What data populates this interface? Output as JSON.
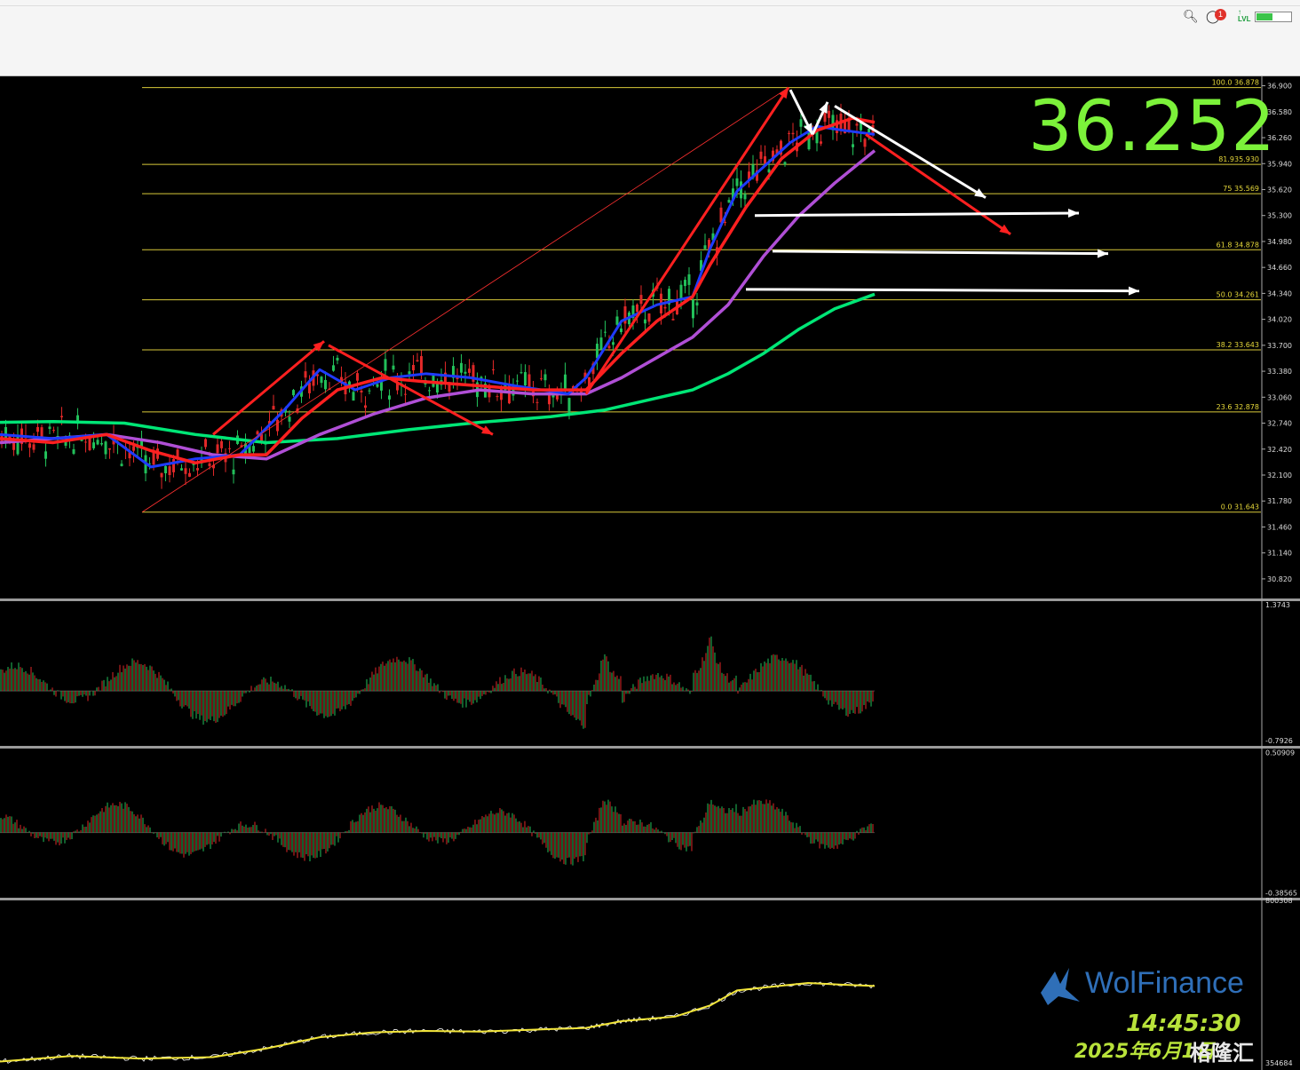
{
  "topbar": {
    "notification_count": "1",
    "lvl_label": "LVL",
    "battery_level": 0.45
  },
  "overlay": {
    "big_price": "36.252",
    "logo": "WolFinance",
    "clock": "14:45:30",
    "date": "2025年6月1日",
    "watermark": "格隆汇"
  },
  "chart_data": [
    {
      "type": "line",
      "panel": "price",
      "y_ticks": [
        "36.900",
        "36.580",
        "36.260",
        "35.940",
        "35.620",
        "35.300",
        "34.980",
        "34.660",
        "34.340",
        "34.020",
        "33.700",
        "33.380",
        "33.060",
        "32.740",
        "32.420",
        "32.100",
        "31.780",
        "31.460",
        "31.140",
        "30.820"
      ],
      "ylim": [
        30.6,
        36.95
      ],
      "fib_levels": [
        {
          "label": "100.0 36.878",
          "value": 36.878
        },
        {
          "label": "81.935.930",
          "value": 35.93
        },
        {
          "label": "75 35.569",
          "value": 35.569
        },
        {
          "label": "61.8 34.878",
          "value": 34.878
        },
        {
          "label": "50.0 34.261",
          "value": 34.261
        },
        {
          "label": "38.2 33.643",
          "value": 33.643
        },
        {
          "label": "23.6 32.878",
          "value": 32.878
        },
        {
          "label": "0.0 31.643",
          "value": 31.643
        }
      ],
      "series": [
        {
          "color": "#00e676",
          "x": [
            0,
            60,
            140,
            220,
            300,
            380,
            460,
            540,
            620,
            680,
            740,
            780,
            820,
            860,
            900,
            940,
            985
          ],
          "values": [
            32.75,
            32.76,
            32.74,
            32.6,
            32.5,
            32.55,
            32.66,
            32.75,
            32.82,
            32.9,
            33.05,
            33.15,
            33.35,
            33.6,
            33.9,
            34.15,
            34.33
          ]
        },
        {
          "color": "#b04fd6",
          "x": [
            0,
            60,
            120,
            180,
            240,
            300,
            360,
            420,
            480,
            540,
            600,
            660,
            700,
            740,
            780,
            820,
            860,
            900,
            940,
            985
          ],
          "values": [
            32.5,
            32.55,
            32.6,
            32.5,
            32.35,
            32.3,
            32.6,
            32.85,
            33.05,
            33.15,
            33.1,
            33.1,
            33.3,
            33.55,
            33.8,
            34.2,
            34.8,
            35.3,
            35.7,
            36.1
          ]
        },
        {
          "color": "#1f3bff",
          "x": [
            0,
            60,
            120,
            170,
            220,
            270,
            320,
            360,
            400,
            440,
            480,
            530,
            580,
            640,
            660,
            700,
            740,
            780,
            800,
            830,
            860,
            890,
            920,
            950,
            985
          ],
          "values": [
            32.6,
            32.55,
            32.6,
            32.2,
            32.3,
            32.35,
            32.9,
            33.4,
            33.15,
            33.3,
            33.35,
            33.3,
            33.2,
            33.1,
            33.3,
            34.0,
            34.2,
            34.3,
            34.9,
            35.6,
            35.9,
            36.2,
            36.4,
            36.35,
            36.3
          ]
        },
        {
          "color": "#ff2020",
          "x": [
            0,
            60,
            120,
            170,
            220,
            270,
            300,
            340,
            380,
            430,
            480,
            540,
            600,
            660,
            700,
            740,
            780,
            800,
            840,
            880,
            920,
            960,
            985
          ],
          "values": [
            32.55,
            32.5,
            32.6,
            32.4,
            32.25,
            32.35,
            32.35,
            32.8,
            33.15,
            33.3,
            33.25,
            33.2,
            33.15,
            33.15,
            33.6,
            34.0,
            34.3,
            34.7,
            35.4,
            36.0,
            36.35,
            36.5,
            36.45
          ]
        }
      ],
      "trend_arrows": [
        {
          "color": "#ff2020",
          "x1": 240,
          "y1": 32.6,
          "x2": 365,
          "y2": 33.75
        },
        {
          "color": "#ff2020",
          "x1": 370,
          "y1": 33.7,
          "x2": 555,
          "y2": 32.6
        },
        {
          "color": "#ff2020",
          "x1": 660,
          "y1": 33.1,
          "x2": 888,
          "y2": 36.88
        },
        {
          "color": "#ff2020",
          "x1": 975,
          "y1": 36.3,
          "x2": 1138,
          "y2": 35.07
        },
        {
          "color": "#ffffff",
          "x1": 890,
          "y1": 36.85,
          "x2": 915,
          "y2": 36.3
        },
        {
          "color": "#ffffff",
          "x1": 915,
          "y1": 36.3,
          "x2": 932,
          "y2": 36.7
        },
        {
          "color": "#ffffff",
          "x1": 940,
          "y1": 36.65,
          "x2": 1110,
          "y2": 35.52
        },
        {
          "color": "#ffffff",
          "x1": 850,
          "y1": 35.3,
          "x2": 1215,
          "y2": 35.33
        },
        {
          "color": "#ffffff",
          "x1": 870,
          "y1": 34.86,
          "x2": 1248,
          "y2": 34.83
        },
        {
          "color": "#ffffff",
          "x1": 840,
          "y1": 34.39,
          "x2": 1283,
          "y2": 34.37
        }
      ]
    },
    {
      "type": "bar",
      "panel": "oscillator_1",
      "y_ticks": [
        "1.3743",
        "-0.7926"
      ],
      "ylim": [
        -0.85,
        1.42
      ]
    },
    {
      "type": "bar",
      "panel": "oscillator_2",
      "y_ticks": [
        "0.50909",
        "-0.38565"
      ],
      "ylim": [
        -0.41,
        0.53
      ]
    },
    {
      "type": "line",
      "panel": "volume_cumulative",
      "y_ticks": [
        "800308",
        "354684"
      ],
      "ylim": [
        354684,
        800308
      ],
      "series": [
        {
          "color": "#f2e53a",
          "x": [
            0,
            80,
            160,
            240,
            300,
            360,
            420,
            480,
            540,
            600,
            660,
            700,
            760,
            800,
            830,
            870,
            910,
            950,
            985
          ],
          "values": [
            370000,
            385000,
            378000,
            382000,
            405000,
            435000,
            448000,
            452000,
            450000,
            455000,
            460000,
            478000,
            490000,
            520000,
            560000,
            570000,
            580000,
            575000,
            572000
          ]
        }
      ]
    }
  ]
}
